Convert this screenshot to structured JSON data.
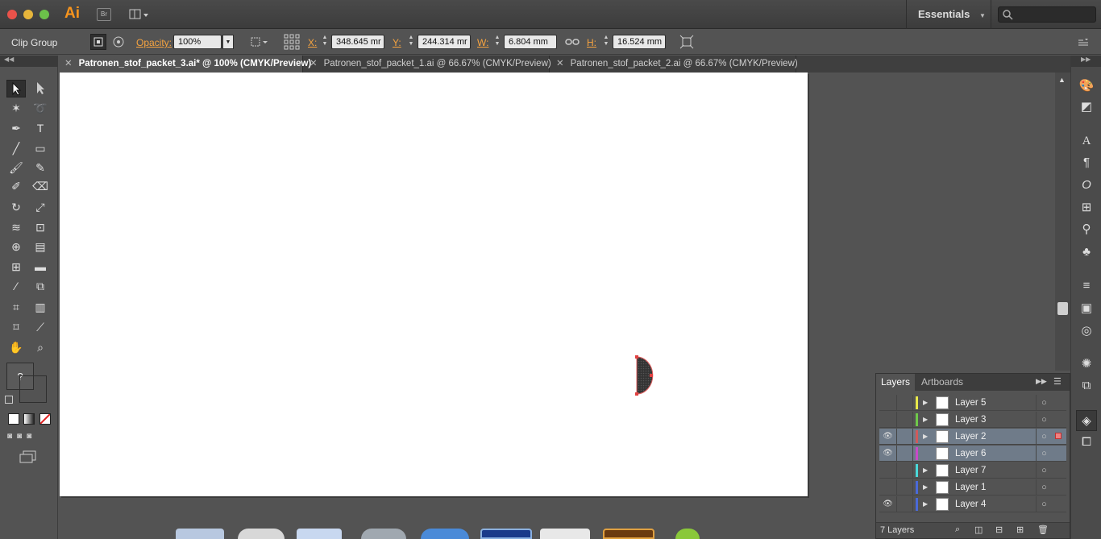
{
  "app": {
    "logo": "Ai",
    "bridge_label": "Br",
    "workspace": "Essentials",
    "search_placeholder": ""
  },
  "control_bar": {
    "selection_type": "Clip Group",
    "opacity_label": "Opacity:",
    "opacity_value": "100%",
    "x_label": "X:",
    "x_value": "348.645 mr",
    "y_label": "Y:",
    "y_value": "244.314 mr",
    "w_label": "W:",
    "w_value": "6.804 mm",
    "h_label": "H:",
    "h_value": "16.524 mm"
  },
  "tabs": [
    {
      "label": "Patronen_stof_packet_3.ai* @ 100% (CMYK/Preview)",
      "active": true
    },
    {
      "label": "Patronen_stof_packet_1.ai @ 66.67% (CMYK/Preview)",
      "active": false
    },
    {
      "label": "Patronen_stof_packet_2.ai @ 66.67% (CMYK/Preview)",
      "active": false
    }
  ],
  "layers_panel": {
    "tabs": [
      "Layers",
      "Artboards"
    ],
    "layers": [
      {
        "name": "Layer 5",
        "color": "#e8e84a",
        "visible": false,
        "selected": false
      },
      {
        "name": "Layer 3",
        "color": "#6fc84a",
        "visible": false,
        "selected": false
      },
      {
        "name": "Layer 2",
        "color": "#d05a5a",
        "visible": true,
        "selected": true
      },
      {
        "name": "Layer 6",
        "color": "#c84ac8",
        "visible": true,
        "selected": true
      },
      {
        "name": "Layer 7",
        "color": "#4ad8d8",
        "visible": false,
        "selected": false
      },
      {
        "name": "Layer 1",
        "color": "#4a6ad8",
        "visible": false,
        "selected": false
      },
      {
        "name": "Layer 4",
        "color": "#4a6ad8",
        "visible": true,
        "selected": false
      }
    ],
    "footer_count": "7 Layers"
  },
  "tools_help": "?"
}
